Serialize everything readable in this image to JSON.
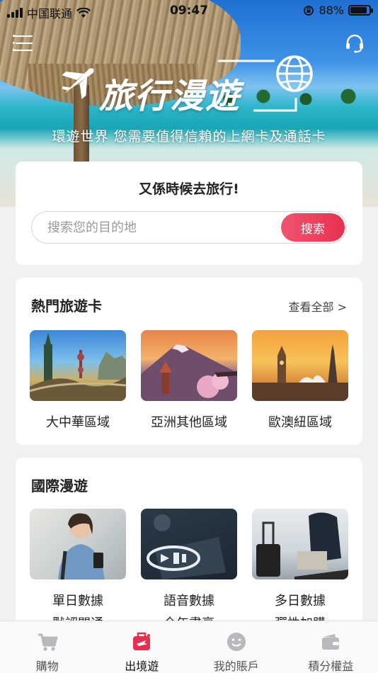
{
  "status_bar": {
    "carrier": "中国联通",
    "time": "09:47",
    "battery": "88%"
  },
  "hero": {
    "logo_text": "旅行漫遊",
    "tagline": "環遊世界 您需要值得信賴的上網卡及通話卡"
  },
  "search": {
    "title": "又係時候去旅行!",
    "placeholder": "搜索您的目的地",
    "button_label": "搜索"
  },
  "hot_cards": {
    "title": "熱門旅遊卡",
    "view_all": "查看全部 >",
    "items": [
      {
        "label": "大中華區域"
      },
      {
        "label": "亞洲其他區域"
      },
      {
        "label": "歐澳紐區域"
      }
    ]
  },
  "international": {
    "title": "國際漫遊",
    "items": [
      {
        "label": "單日數據",
        "sub": "默認開通"
      },
      {
        "label": "語音數據",
        "sub": "全年盡享"
      },
      {
        "label": "多日數據",
        "sub": "彈性加購"
      }
    ]
  },
  "tabbar": {
    "items": [
      {
        "label": "購物",
        "icon": "cart-icon"
      },
      {
        "label": "出境遊",
        "icon": "suitcase-icon"
      },
      {
        "label": "我的賬戶",
        "icon": "smiley-icon"
      },
      {
        "label": "積分權益",
        "icon": "wallet-icon"
      }
    ],
    "active_index": 1
  },
  "colors": {
    "accent": "#e7304f",
    "inactive": "#b9b9bd"
  }
}
